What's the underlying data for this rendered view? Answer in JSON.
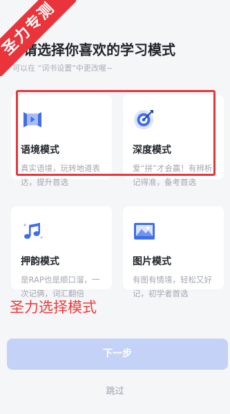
{
  "ribbon": {
    "text": "圣力专测"
  },
  "header": {
    "title": "请选择你喜欢的学习模式",
    "subtitle": "可以在 “词书设置”中更改喔~"
  },
  "modes": [
    {
      "name": "语境模式",
      "desc": "真实语境，玩转地道表达，提升首选",
      "icon": "play-video-icon"
    },
    {
      "name": "深度模式",
      "desc": "爱“拼”才会赢！有辨析记得准，备考首选",
      "icon": "target-dart-icon"
    },
    {
      "name": "押韵模式",
      "desc": "是RAP也是顺口溜，一次记俩，词汇翻倍",
      "icon": "music-note-icon"
    },
    {
      "name": "图片模式",
      "desc": "有图有情境，轻松又好记，初学者首选",
      "icon": "mountain-picture-icon"
    }
  ],
  "annotation": "圣力选择模式",
  "actions": {
    "next_label": "下一步",
    "skip_label": "跳过"
  },
  "colors": {
    "accent": "#3f6ee8",
    "button_disabled": "#c5d2f7",
    "highlight_red": "#e8343a"
  }
}
